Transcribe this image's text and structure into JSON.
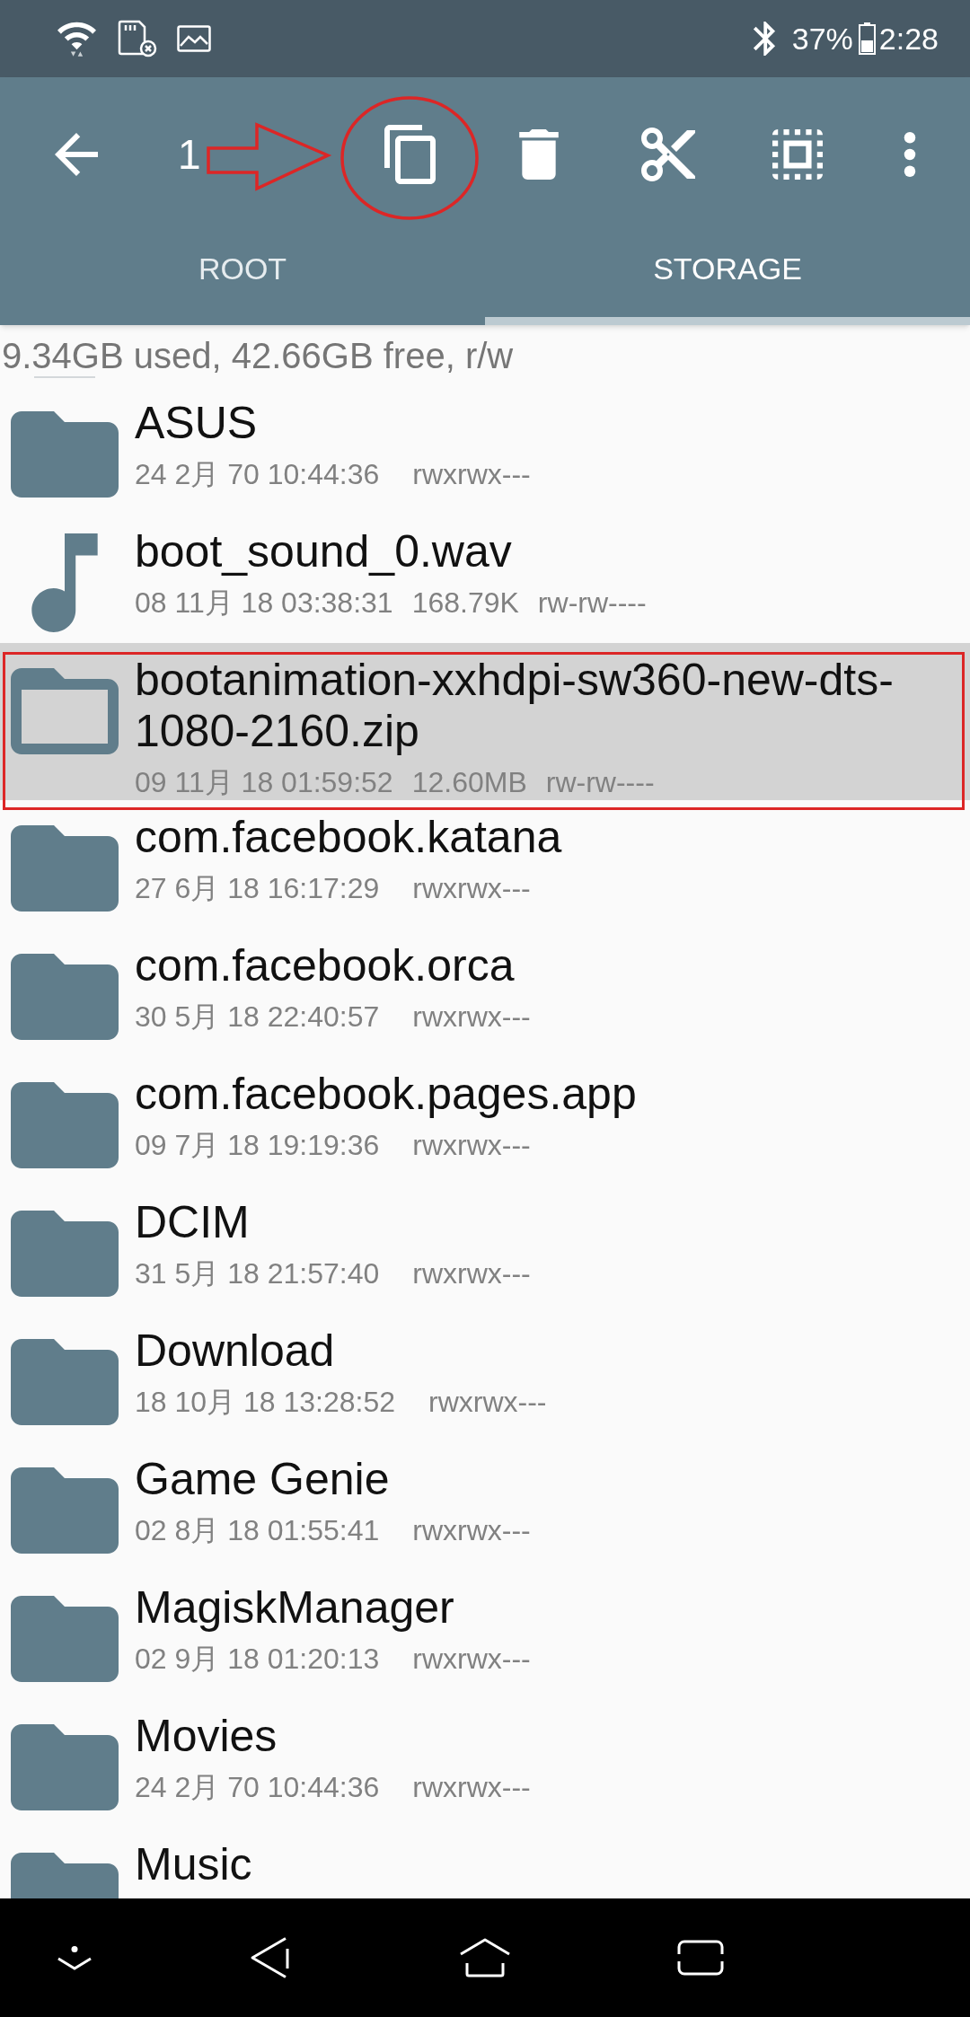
{
  "status_bar": {
    "battery": "37%",
    "time": "2:28"
  },
  "toolbar": {
    "count": "1",
    "arrow_annotation": true,
    "actions": [
      {
        "kind": "copy",
        "circled": true
      },
      {
        "kind": "delete",
        "circled": false
      },
      {
        "kind": "cut",
        "circled": false
      },
      {
        "kind": "select_all",
        "circled": false
      },
      {
        "kind": "more",
        "circled": false
      }
    ]
  },
  "tabs": [
    {
      "label": "ROOT",
      "selected": false
    },
    {
      "label": "STORAGE",
      "selected": true
    }
  ],
  "storage_info": "9.34GB used, 42.66GB free, r/w",
  "files": [
    {
      "kind": "folder",
      "name": "ASUS",
      "date": "24 2月 70 10:44:36",
      "permissions": "rwxrwx---",
      "selected": false,
      "framed": false
    },
    {
      "kind": "audio",
      "name": "boot_sound_0.wav",
      "date": "08 11月 18 03:38:31",
      "size": "168.79K",
      "permissions": "rw-rw----",
      "selected": false,
      "framed": false
    },
    {
      "kind": "folder",
      "name": "bootanimation-xxhdpi-sw360-new-dts-1080-2160.zip",
      "date": "09 11月 18 01:59:52",
      "size": "12.60MB",
      "permissions": "rw-rw----",
      "selected": true,
      "framed": true
    },
    {
      "kind": "folder",
      "name": "com.facebook.katana",
      "date": "27 6月 18 16:17:29",
      "permissions": "rwxrwx---",
      "selected": false,
      "framed": false
    },
    {
      "kind": "folder",
      "name": "com.facebook.orca",
      "date": "30 5月 18 22:40:57",
      "permissions": "rwxrwx---",
      "selected": false,
      "framed": false
    },
    {
      "kind": "folder",
      "name": "com.facebook.pages.app",
      "date": "09 7月 18 19:19:36",
      "permissions": "rwxrwx---",
      "selected": false,
      "framed": false
    },
    {
      "kind": "folder",
      "name": "DCIM",
      "date": "31 5月 18 21:57:40",
      "permissions": "rwxrwx---",
      "selected": false,
      "framed": false
    },
    {
      "kind": "folder",
      "name": "Download",
      "date": "18 10月 18 13:28:52",
      "permissions": "rwxrwx---",
      "selected": false,
      "framed": false
    },
    {
      "kind": "folder",
      "name": "Game Genie",
      "date": "02 8月 18 01:55:41",
      "permissions": "rwxrwx---",
      "selected": false,
      "framed": false
    },
    {
      "kind": "folder",
      "name": "MagiskManager",
      "date": "02 9月 18 01:20:13",
      "permissions": "rwxrwx---",
      "selected": false,
      "framed": false
    },
    {
      "kind": "folder",
      "name": "Movies",
      "date": "24 2月 70 10:44:36",
      "permissions": "rwxrwx---",
      "selected": false,
      "framed": false
    },
    {
      "kind": "folder",
      "name": "Music",
      "selected": false,
      "framed": false
    }
  ]
}
